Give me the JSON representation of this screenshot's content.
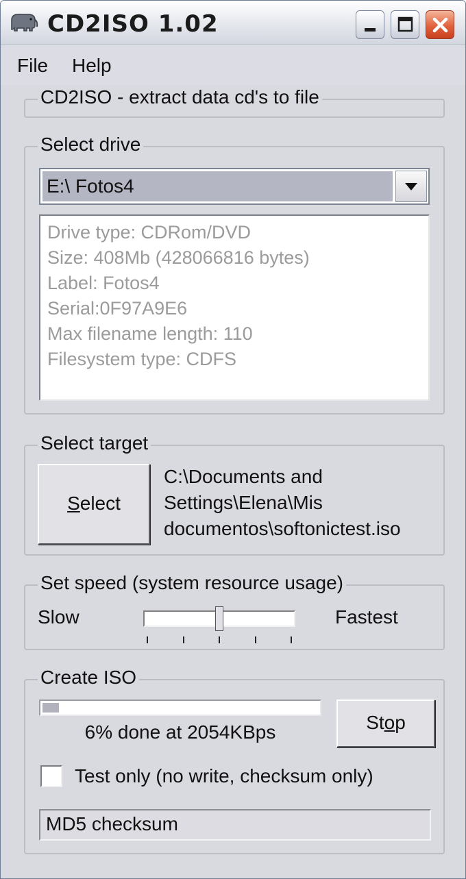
{
  "window": {
    "title": "CD2ISO 1.02",
    "icon": "elephant-icon",
    "controls": [
      "minimize-icon",
      "maximize-icon",
      "close-icon"
    ]
  },
  "menu": {
    "file": "File",
    "help": "Help"
  },
  "header": {
    "label": "CD2ISO - extract data cd's to file"
  },
  "drive": {
    "group_label": "Select drive",
    "selected": "E:\\ Fotos4",
    "info": [
      "Drive type: CDRom/DVD",
      "Size: 408Mb (428066816 bytes)",
      "Label: Fotos4",
      "Serial:0F97A9E6",
      "Max filename length: 110",
      "Filesystem type: CDFS"
    ]
  },
  "target": {
    "group_label": "Select target",
    "button_label": "Select",
    "path_lines": [
      "C:\\Documents and",
      "Settings\\Elena\\Mis",
      "documentos\\softonictest.iso"
    ]
  },
  "speed": {
    "group_label": "Set speed (system resource usage)",
    "slow_label": "Slow",
    "fast_label": "Fastest",
    "ticks": 5,
    "position": 2
  },
  "iso": {
    "group_label": "Create ISO",
    "progress_percent": 6,
    "progress_text": "6% done at 2054KBps",
    "stop_label": "Stop",
    "test_only_label": "Test only (no write, checksum only)",
    "test_only_checked": false,
    "md5": "MD5 checksum"
  },
  "colors": {
    "window_bg": "#d9d9e0",
    "info_text": "#9b9b9b",
    "combo_highlight": "#b4b6c4",
    "close_button": "#e2623d"
  }
}
